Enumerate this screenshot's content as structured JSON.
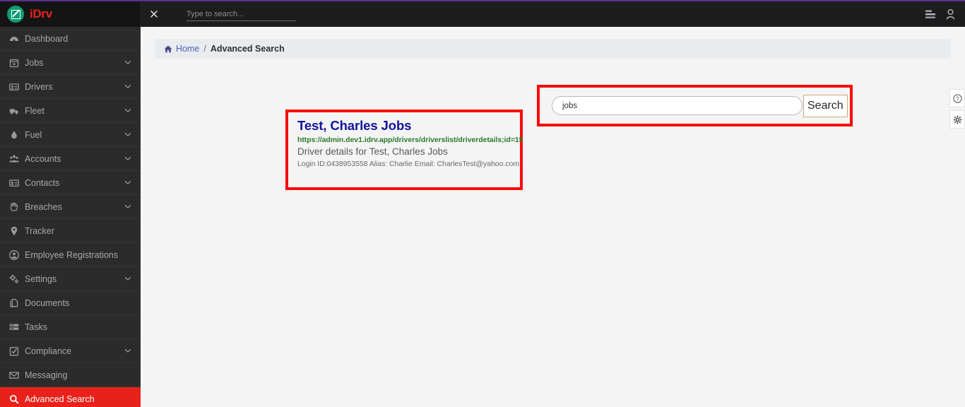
{
  "header": {
    "brand_name": "iDrv",
    "logo_icon": "idrv-logo-icon",
    "close_icon": "close-icon",
    "search_placeholder": "Type to search...",
    "search_value": "",
    "list_icon": "list-icon",
    "user_icon": "user-icon"
  },
  "sidebar": {
    "items": [
      {
        "label": "Dashboard",
        "icon": "dashboard-icon",
        "has_chevron": false,
        "active": false
      },
      {
        "label": "Jobs",
        "icon": "calendar-plus-icon",
        "has_chevron": true,
        "active": false
      },
      {
        "label": "Drivers",
        "icon": "id-card-icon",
        "has_chevron": true,
        "active": false
      },
      {
        "label": "Fleet",
        "icon": "truck-icon",
        "has_chevron": true,
        "active": false
      },
      {
        "label": "Fuel",
        "icon": "fuel-drop-icon",
        "has_chevron": true,
        "active": false
      },
      {
        "label": "Accounts",
        "icon": "users-group-icon",
        "has_chevron": true,
        "active": false
      },
      {
        "label": "Contacts",
        "icon": "contact-card-icon",
        "has_chevron": true,
        "active": false
      },
      {
        "label": "Breaches",
        "icon": "hand-icon",
        "has_chevron": true,
        "active": false
      },
      {
        "label": "Tracker",
        "icon": "map-pin-icon",
        "has_chevron": false,
        "active": false
      },
      {
        "label": "Employee Registrations",
        "icon": "user-circle-icon",
        "has_chevron": false,
        "active": false
      },
      {
        "label": "Settings",
        "icon": "gears-icon",
        "has_chevron": true,
        "active": false
      },
      {
        "label": "Documents",
        "icon": "documents-icon",
        "has_chevron": false,
        "active": false
      },
      {
        "label": "Tasks",
        "icon": "tasks-icon",
        "has_chevron": false,
        "active": false
      },
      {
        "label": "Compliance",
        "icon": "check-square-icon",
        "has_chevron": true,
        "active": false
      },
      {
        "label": "Messaging",
        "icon": "envelope-icon",
        "has_chevron": false,
        "active": false
      },
      {
        "label": "Advanced Search",
        "icon": "magnifier-icon",
        "has_chevron": false,
        "active": true
      }
    ]
  },
  "breadcrumb": {
    "home_icon": "home-icon",
    "home_label": "Home",
    "separator": "/",
    "current_label": "Advanced Search"
  },
  "search_panel": {
    "input_value": "jobs",
    "input_placeholder": "",
    "button_label": "Search"
  },
  "results": [
    {
      "title": "Test, Charles Jobs",
      "url": "https://admin.dev1.idrv.app/drivers/driverslist/driverdetails;id=15",
      "snippet": "Driver details for Test, Charles Jobs",
      "meta": "Login ID:0438953558 Alias: Charlie Email: CharlesTest@yahoo.com"
    }
  ],
  "float_buttons": [
    {
      "icon": "help-circle-icon"
    },
    {
      "icon": "gear-icon"
    }
  ],
  "colors": {
    "accent_red": "#e8211a",
    "annotation_red": "#fb0b0b",
    "brand_teal": "#0f9b72",
    "purple_rule": "#5c2d91",
    "result_title_blue": "#12129c",
    "result_url_green": "#2b7a2b",
    "button_border_tan": "#c8a878"
  }
}
